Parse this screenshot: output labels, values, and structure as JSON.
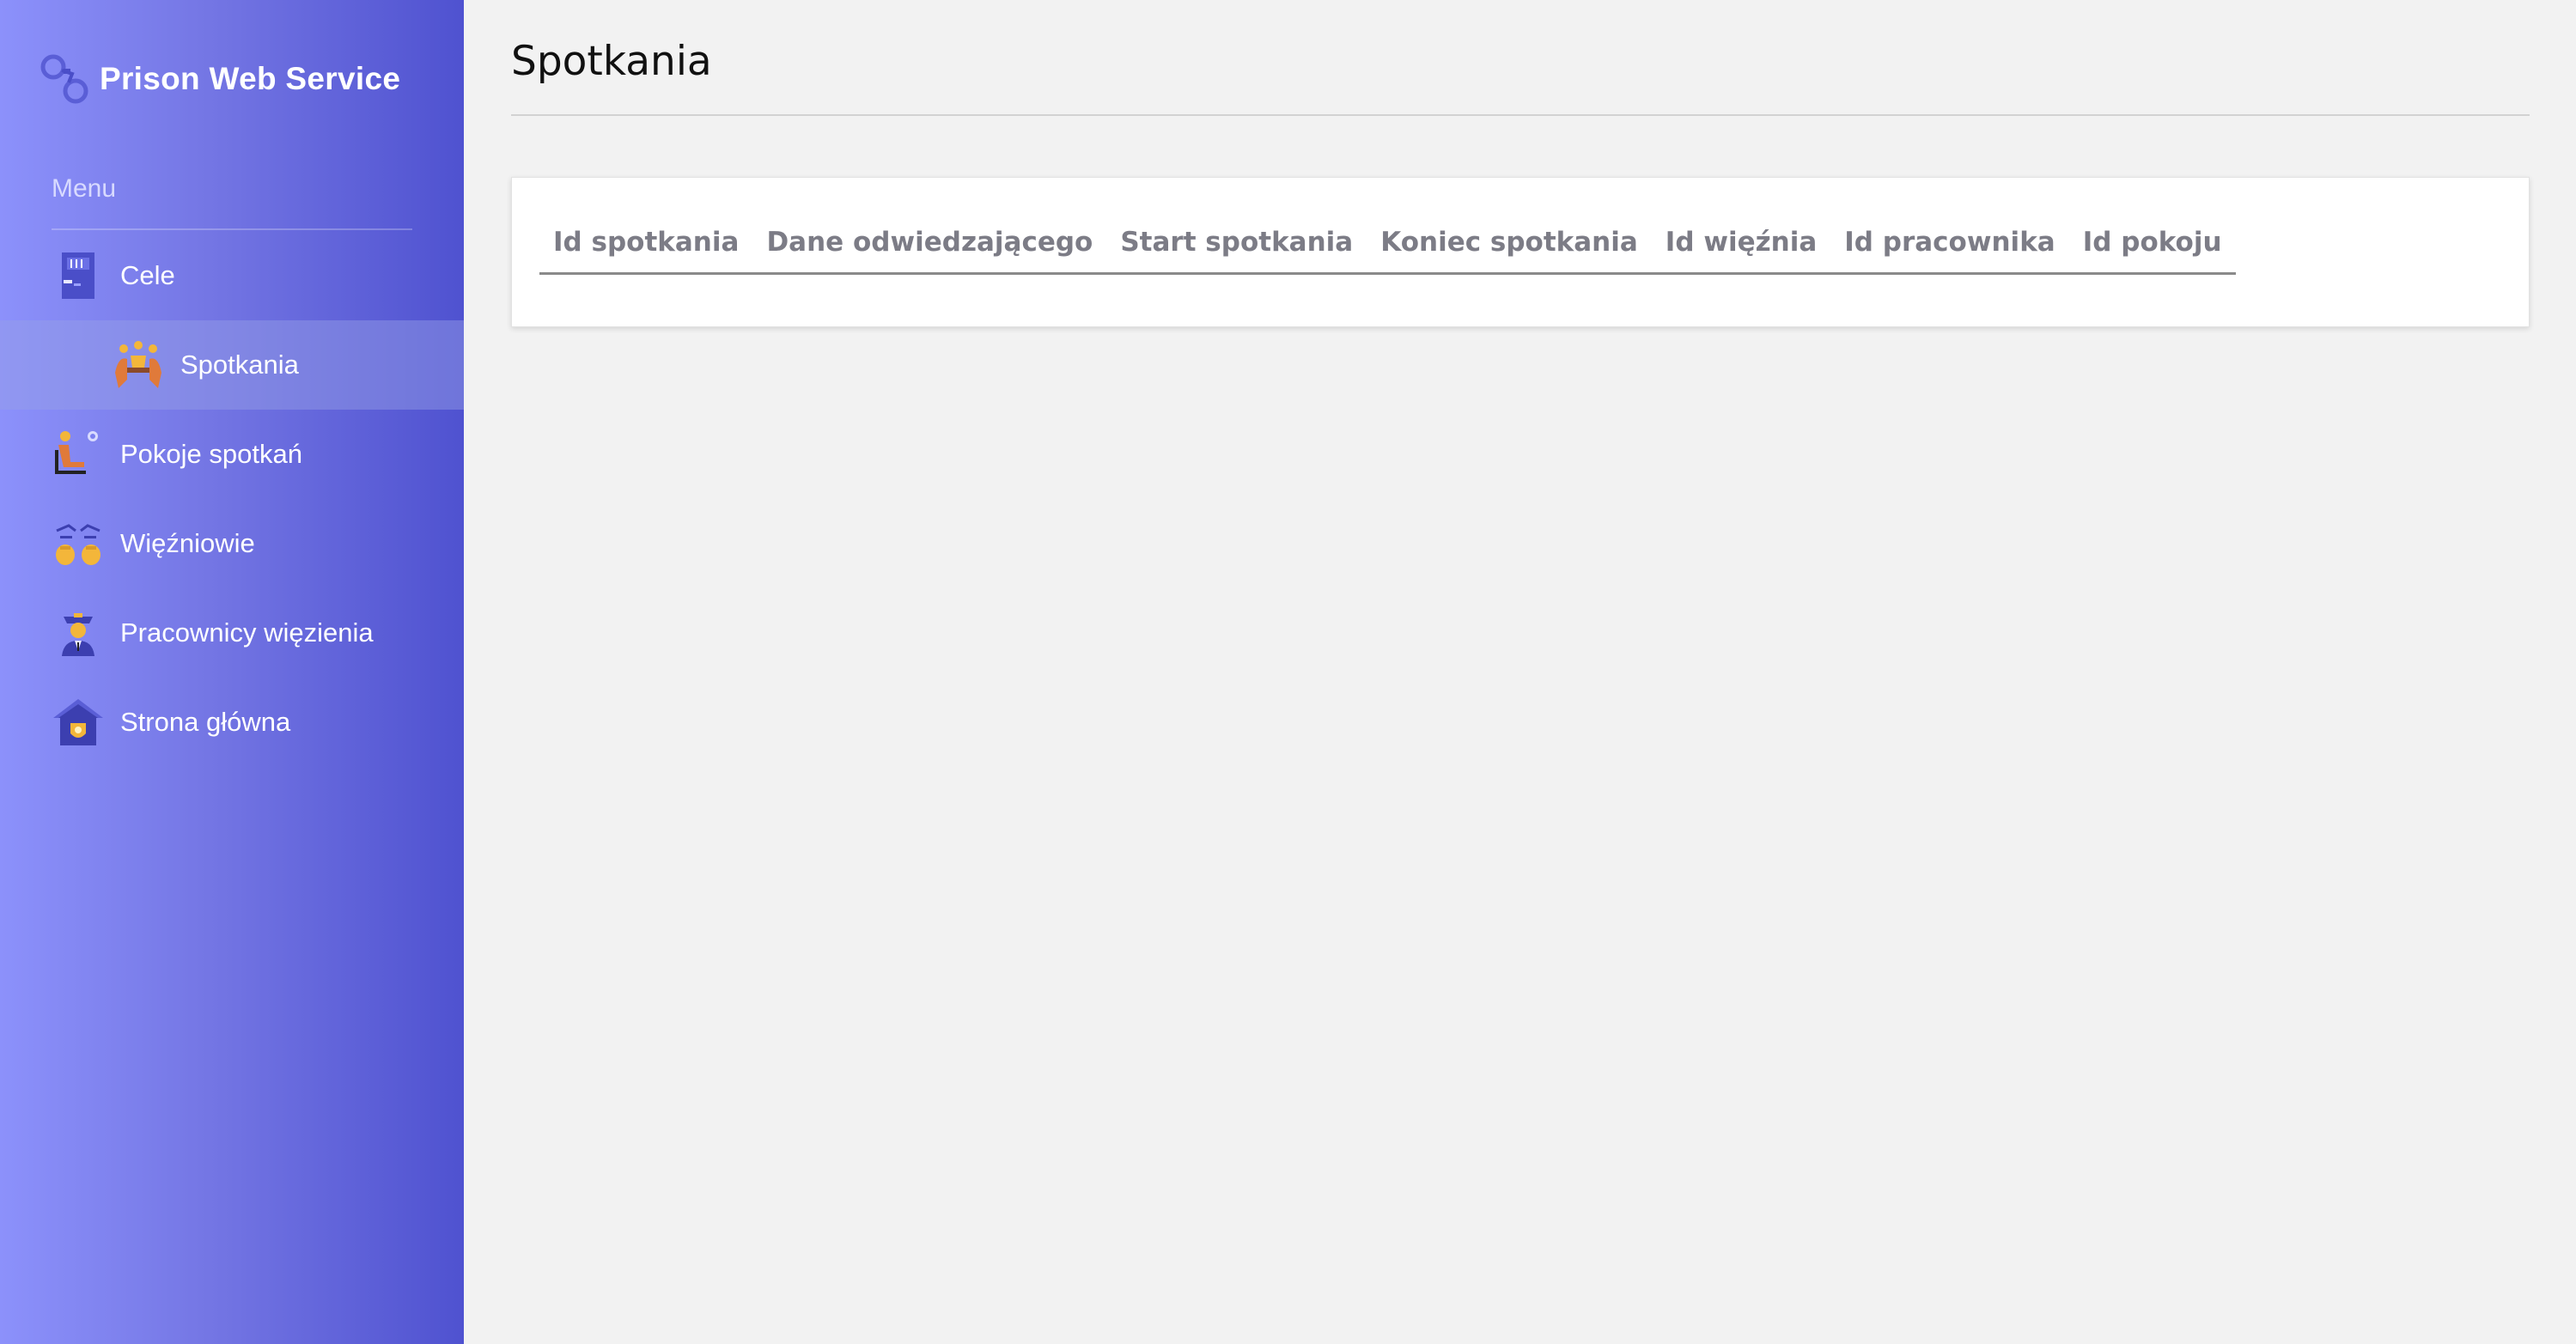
{
  "app": {
    "title": "Prison Web Service"
  },
  "sidebar": {
    "menu_label": "Menu",
    "items": [
      {
        "label": "Cele",
        "icon": "cell-door-icon",
        "level": "top",
        "active": false
      },
      {
        "label": "Spotkania",
        "icon": "meeting-icon",
        "level": "sub",
        "active": true
      },
      {
        "label": "Pokoje spotkań",
        "icon": "visiting-room-icon",
        "level": "top",
        "active": false
      },
      {
        "label": "Więźniowie",
        "icon": "prisoners-icon",
        "level": "top",
        "active": false
      },
      {
        "label": "Pracownicy więzienia",
        "icon": "prison-guard-icon",
        "level": "top",
        "active": false
      },
      {
        "label": "Strona główna",
        "icon": "home-badge-icon",
        "level": "top",
        "active": false
      }
    ]
  },
  "main": {
    "page_title": "Spotkania",
    "table": {
      "columns": [
        "Id spotkania",
        "Dane odwiedzającego",
        "Start spotkania",
        "Koniec spotkania",
        "Id więźnia",
        "Id pracownika",
        "Id pokoju"
      ],
      "rows": []
    }
  },
  "colors": {
    "sidebar_gradient_start": "#8c91fb",
    "sidebar_gradient_end": "#4f52d0",
    "page_background": "#f2f2f2",
    "header_text": "#7c7c86"
  }
}
